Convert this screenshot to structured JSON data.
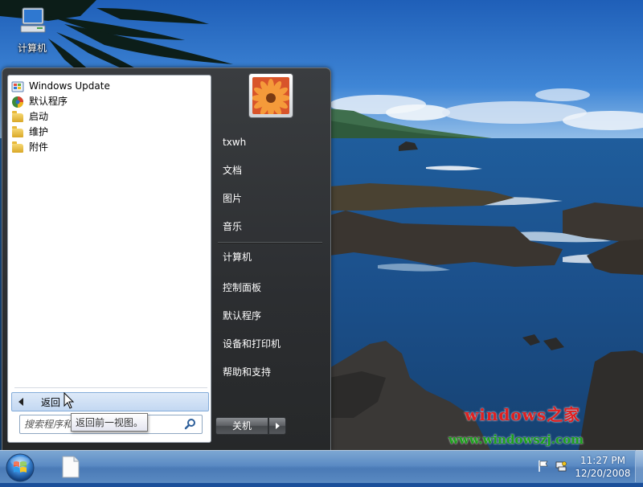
{
  "desktop": {
    "icons": [
      {
        "label": "计算机",
        "icon": "computer-icon"
      }
    ],
    "watermark": {
      "title": "windows之家",
      "url": "www.windowszj.com"
    }
  },
  "start_menu": {
    "programs": [
      {
        "label": "Windows Update",
        "icon": "windows-update-icon"
      },
      {
        "label": "默认程序",
        "icon": "default-programs-icon"
      },
      {
        "label": "启动",
        "icon": "folder-icon"
      },
      {
        "label": "维护",
        "icon": "folder-icon"
      },
      {
        "label": "附件",
        "icon": "folder-icon"
      }
    ],
    "back_label": "返回",
    "back_tooltip": "返回前一视图。",
    "search_placeholder": "搜索程序和文件",
    "right_items": {
      "user": "txwh",
      "documents": "文档",
      "pictures": "图片",
      "music": "音乐",
      "computer": "计算机",
      "control_panel": "控制面板",
      "default_programs": "默认程序",
      "devices_printers": "设备和打印机",
      "help_support": "帮助和支持"
    },
    "shutdown_label": "关机"
  },
  "taskbar": {
    "time": "11:27 PM",
    "date": "12/20/2008",
    "colors": {
      "accent": "#5b8bc4"
    }
  }
}
